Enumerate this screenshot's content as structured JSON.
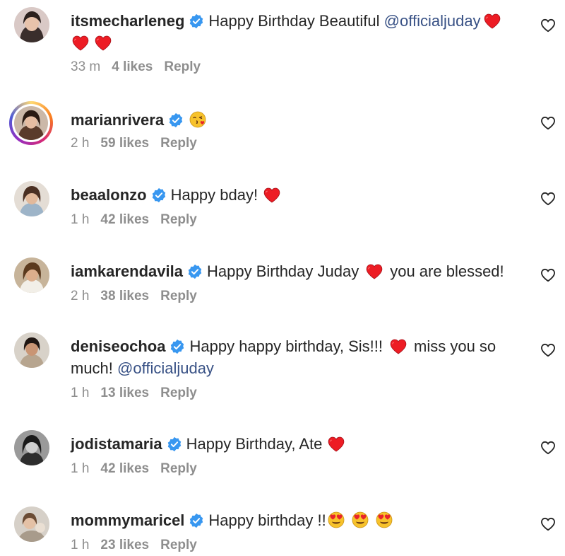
{
  "colors": {
    "verified": "#3897f0",
    "heart": "#ed1c24",
    "mention": "#385185",
    "meta": "#8e8e8e"
  },
  "comments": [
    {
      "username": "itsmecharleneg",
      "text_before": "Happy Birthday Beautiful",
      "mention": "@officialjuday",
      "text_after": "",
      "time": "33 m",
      "likes": "4 likes",
      "reply": "Reply",
      "icons": [
        "verified-badge-icon",
        "heart-icon",
        "heart-icon",
        "heart-icon",
        "like-heart-outline-icon"
      ]
    },
    {
      "username": "marianrivera",
      "text_before": "",
      "time": "2 h",
      "likes": "59 likes",
      "reply": "Reply",
      "icons": [
        "verified-badge-icon",
        "face-blowing-kiss-emoji",
        "story-ring",
        "like-heart-outline-icon"
      ]
    },
    {
      "username": "beaalonzo",
      "text_before": "Happy bday!",
      "time": "1 h",
      "likes": "42 likes",
      "reply": "Reply",
      "icons": [
        "verified-badge-icon",
        "heart-icon",
        "like-heart-outline-icon"
      ]
    },
    {
      "username": "iamkarendavila",
      "text_before": "Happy Birthday Juday",
      "text_after": "you are blessed!",
      "time": "2 h",
      "likes": "38 likes",
      "reply": "Reply",
      "icons": [
        "verified-badge-icon",
        "heart-icon",
        "like-heart-outline-icon"
      ]
    },
    {
      "username": "deniseochoa",
      "text_before": "Happy happy birthday, Sis!!!",
      "text_after": "miss you so much!",
      "mention": "@officialjuday",
      "time": "1 h",
      "likes": "13 likes",
      "reply": "Reply",
      "icons": [
        "verified-badge-icon",
        "heart-icon",
        "like-heart-outline-icon"
      ]
    },
    {
      "username": "jodistamaria",
      "text_before": "Happy Birthday, Ate",
      "time": "1 h",
      "likes": "42 likes",
      "reply": "Reply",
      "icons": [
        "verified-badge-icon",
        "heart-icon",
        "like-heart-outline-icon"
      ]
    },
    {
      "username": "mommymaricel",
      "text_before": "Happy birthday !!",
      "time": "1 h",
      "likes": "23 likes",
      "reply": "Reply",
      "icons": [
        "verified-badge-icon",
        "heart-eyes-emoji",
        "heart-eyes-emoji",
        "heart-eyes-emoji",
        "like-heart-outline-icon"
      ]
    }
  ]
}
